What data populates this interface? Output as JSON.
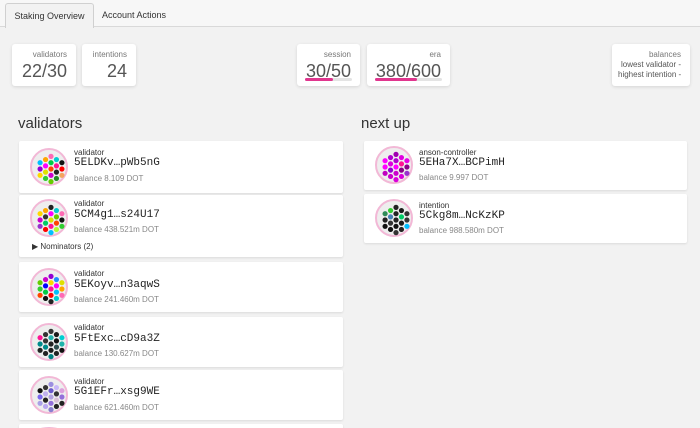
{
  "tabs": [
    {
      "label": "Staking Overview",
      "active": true
    },
    {
      "label": "Account Actions",
      "active": false
    }
  ],
  "summary": {
    "validators": {
      "label": "validators",
      "value": "22/30"
    },
    "intentions": {
      "label": "intentions",
      "value": "24"
    },
    "session": {
      "label": "session",
      "value": "30/50",
      "progress": 0.6
    },
    "era": {
      "label": "era",
      "value": "380/600",
      "progress": 0.633
    },
    "balances": {
      "label": "balances",
      "lowest": "lowest validator -",
      "highest": "highest intention -"
    }
  },
  "sections": {
    "validators": "validators",
    "next_up": "next up"
  },
  "validators": [
    {
      "kind": "validator",
      "address": "5ELDKv…pWb5nG",
      "balance": "balance 8.109 DOT",
      "colors": [
        "#ff4500",
        "#cc00cc",
        "#e0e000",
        "#ff00ff",
        "#00cc44",
        "#ff1493",
        "#222222",
        "#66cc00",
        "#ffd700",
        "#00bfff",
        "#ff69b4",
        "#111111",
        "#f4a460",
        "#32cd32",
        "#9400d3",
        "#ffa500",
        "#00ced1",
        "#ff0000",
        "#228b22"
      ]
    },
    {
      "kind": "validator",
      "address": "5CM4g1…s24U17",
      "balance": "balance 438.521m DOT",
      "nominators": "Nominators (2)",
      "colors": [
        "#e0e000",
        "#ff1493",
        "#00cc66",
        "#333333",
        "#ff00ff",
        "#66cc00",
        "#ff4500",
        "#00bfff",
        "#9932cc",
        "#ffd700",
        "#222222",
        "#ff69b4",
        "#32cd32",
        "#ff0000",
        "#cc00cc",
        "#ffa500",
        "#00ced1",
        "#111111",
        "#adff2f"
      ]
    },
    {
      "kind": "validator",
      "address": "5EKoyv…n3aqwS",
      "balance": "balance 241.460m DOT",
      "colors": [
        "#ff1493",
        "#ff0000",
        "#00cc44",
        "#0000ff",
        "#ffd700",
        "#ff00ff",
        "#00bfff",
        "#222222",
        "#ff4500",
        "#66cc00",
        "#9400d3",
        "#e0e000",
        "#ff69b4",
        "#111111",
        "#32cd32",
        "#cc00cc",
        "#1e90ff",
        "#ffa500",
        "#00ced1"
      ]
    },
    {
      "kind": "validator",
      "address": "5FtExc…cD9a3Z",
      "balance": "balance 130.627m DOT",
      "colors": [
        "#222222",
        "#1a1a1a",
        "#008b8b",
        "#333333",
        "#20b2aa",
        "#111111",
        "#2f4f4f",
        "#008080",
        "#222222",
        "#ff1493",
        "#333333",
        "#00ced1",
        "#111111",
        "#222222",
        "#008b8b",
        "#333333",
        "#1a1a1a",
        "#20b2aa",
        "#222222"
      ]
    },
    {
      "kind": "validator",
      "address": "5G1EFr…xsg9WE",
      "balance": "balance 621.460m DOT",
      "colors": [
        "#b0a0e0",
        "#9370db",
        "#222222",
        "#c0b0f0",
        "#6a5acd",
        "#333333",
        "#d8bfd8",
        "#8a7fd0",
        "#a9a0e8",
        "#111111",
        "#9b8fe0",
        "#dda0dd",
        "#222222",
        "#b8a8f0",
        "#7b68ee",
        "#333333",
        "#c8b8f8",
        "#9370db",
        "#222222"
      ]
    }
  ],
  "next_up": [
    {
      "kind": "anson-controller",
      "address": "5EHa7X…BCPimH",
      "balance": "balance 9.997 DOT",
      "colors": [
        "#ff00ff",
        "#cc00cc",
        "#9400d3",
        "#e000e0",
        "#b000d0",
        "#ff1493",
        "#8b008b",
        "#da00da",
        "#c000c0",
        "#ff00ff",
        "#a000b0",
        "#e600e6",
        "#9932cc",
        "#cc00cc",
        "#ff00ff",
        "#b000d0",
        "#e000e0",
        "#8b008b",
        "#da00da"
      ]
    },
    {
      "kind": "intention",
      "address": "5Ckg8m…NcKzKP",
      "balance": "balance 988.580m DOT",
      "colors": [
        "#222222",
        "#111111",
        "#333333",
        "#4682b4",
        "#222222",
        "#00cc66",
        "#1a1a1a",
        "#333333",
        "#111111",
        "#2e8b57",
        "#222222",
        "#333333",
        "#00bfff",
        "#111111",
        "#222222",
        "#32cd32",
        "#1a1a1a",
        "#333333",
        "#222222"
      ]
    }
  ]
}
